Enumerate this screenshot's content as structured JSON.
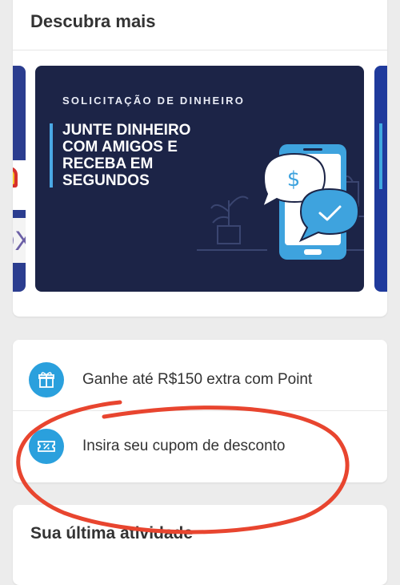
{
  "discover": {
    "title": "Descubra mais",
    "banner": {
      "eyebrow": "SOLICITAÇÃO DE DINHEIRO",
      "headline_lines": [
        "JUNTE DINHEIRO",
        "COM AMIGOS E",
        "RECEBA EM",
        "SEGUNDOS"
      ],
      "icons": [
        "phone-icon",
        "dollar-bubble-icon",
        "check-bubble-icon",
        "plant-icon",
        "shopping-bag-icon",
        "card-icon"
      ]
    },
    "side_banner_text": "OX"
  },
  "options": [
    {
      "label": "Ganhe até R$150 extra com Point",
      "icon": "gift-icon"
    },
    {
      "label": "Insira seu cupom de desconto",
      "icon": "ticket-icon"
    }
  ],
  "activity": {
    "title": "Sua última atividade"
  },
  "colors": {
    "background": "#ececec",
    "banner": "#1c2447",
    "accent_blue": "#2aa0dd",
    "annotation_red": "#e8452f"
  }
}
